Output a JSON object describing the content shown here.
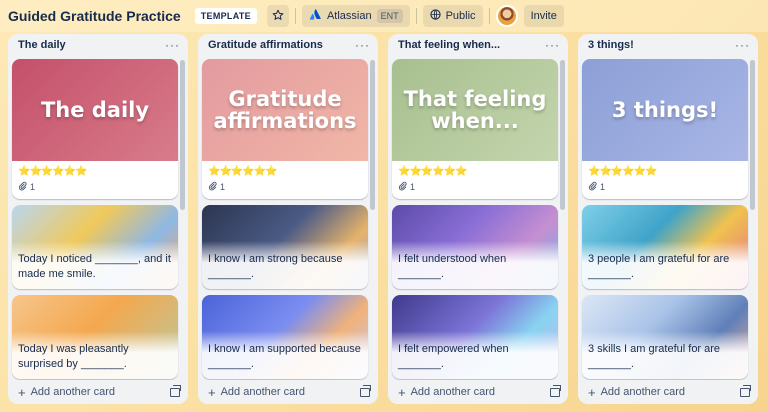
{
  "header": {
    "board_title": "Guided Gratitude Practice",
    "template_badge": "TEMPLATE",
    "workspace_label": "Atlassian",
    "workspace_badge": "ENT",
    "visibility_label": "Public",
    "invite_label": "Invite"
  },
  "icons": {
    "star": "star-icon",
    "workspace": "atlassian-logo-icon",
    "visibility": "globe-icon",
    "attachment": "paperclip-icon",
    "add": "plus-icon",
    "template": "template-icon",
    "more": "more-dots-icon"
  },
  "colors": {
    "board_bg": "#fbe2a6",
    "list_bg": "#f1f2f4",
    "text": "#172b4d",
    "stars": "#f2b600"
  },
  "lists": [
    {
      "title": "The daily",
      "cover_text": "The daily",
      "cover_bg": "linear-gradient(135deg, #c4506a 0%, #d87c8a 100%)",
      "rating": "⭐⭐⭐⭐⭐⭐",
      "attachments": "1",
      "cards": [
        {
          "text": "Today I noticed _______, and it made me smile.",
          "bg": "linear-gradient(135deg,#b9d6f0 0%,#f0c95a 40%,#8fb8e6 70%,#f2a65a 100%)"
        },
        {
          "text": "Today I was pleasantly surprised by _______.",
          "bg": "linear-gradient(135deg,#f6c58c 0%,#f4a84e 45%,#b8c9a0 100%)"
        }
      ],
      "add_label": "Add another card"
    },
    {
      "title": "Gratitude affirmations",
      "cover_text": "Gratitude affirmations",
      "cover_bg": "linear-gradient(135deg, #e39a9f 0%, #f1b7a7 100%)",
      "rating": "⭐⭐⭐⭐⭐⭐",
      "attachments": "1",
      "cards": [
        {
          "text": "I know I am strong because _______.",
          "bg": "linear-gradient(135deg,#2c3550 0%,#4b5b86 45%,#e7b36b 75%,#8ea8d8 100%)"
        },
        {
          "text": "I know I am supported because _______.",
          "bg": "linear-gradient(135deg,#4a63d8 0%,#7b8df0 45%,#f0b27a 70%,#c5c9f5 100%)"
        }
      ],
      "add_label": "Add another card"
    },
    {
      "title": "That feeling when...",
      "cover_text": "That feeling when...",
      "cover_bg": "linear-gradient(135deg, #a7bf8f 0%, #c4d5ad 100%)",
      "rating": "⭐⭐⭐⭐⭐⭐",
      "attachments": "1",
      "cards": [
        {
          "text": "I felt understood when _______.",
          "bg": "linear-gradient(135deg,#5b4ba8 0%,#8a6fd6 40%,#c58fd1 70%,#6fb3e8 100%)"
        },
        {
          "text": "I felt empowered when _______.",
          "bg": "linear-gradient(135deg,#3f3a8c 0%,#7d74d8 45%,#88d3f0 70%,#c8b6f0 100%)"
        }
      ],
      "add_label": "Add another card"
    },
    {
      "title": "3 things!",
      "cover_text": "3 things!",
      "cover_bg": "linear-gradient(135deg, #8c9fd6 0%, #a9b6e6 100%)",
      "rating": "⭐⭐⭐⭐⭐⭐",
      "attachments": "1",
      "cards": [
        {
          "text": "3 people I am grateful for are _______.",
          "bg": "linear-gradient(135deg,#7fd0e8 0%,#3fa3c9 40%,#f0c24e 65%,#e86f8c 100%)"
        },
        {
          "text": "3 skills I am grateful for are _______.",
          "bg": "linear-gradient(135deg,#dce6f5 0%,#a9c3e8 40%,#5f7fb8 70%,#f0b0a0 100%)"
        }
      ],
      "add_label": "Add another card"
    }
  ]
}
